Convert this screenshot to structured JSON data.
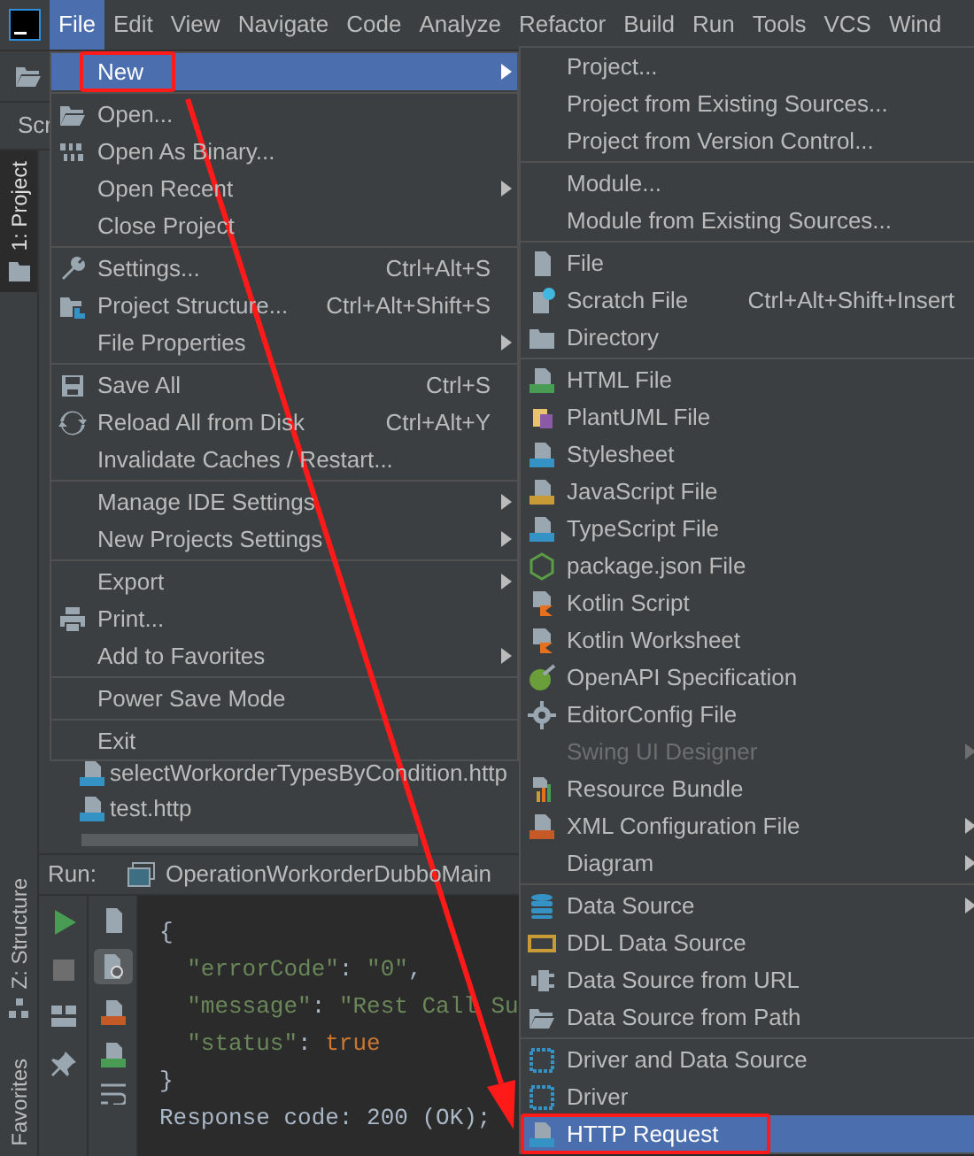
{
  "menu_bar": {
    "items": [
      {
        "label": "File",
        "selected": true
      },
      {
        "label": "Edit",
        "selected": false
      },
      {
        "label": "View",
        "selected": false
      },
      {
        "label": "Navigate",
        "selected": false
      },
      {
        "label": "Code",
        "selected": false
      },
      {
        "label": "Analyze",
        "selected": false
      },
      {
        "label": "Refactor",
        "selected": false
      },
      {
        "label": "Build",
        "selected": false
      },
      {
        "label": "Run",
        "selected": false
      },
      {
        "label": "Tools",
        "selected": false
      },
      {
        "label": "VCS",
        "selected": false
      },
      {
        "label": "Wind",
        "selected": false
      }
    ]
  },
  "tool_tab": "Scr",
  "side_stripe": [
    {
      "label": "1: Project",
      "selected": true
    },
    {
      "label": "Z: Structure",
      "selected": false
    },
    {
      "label": "Favorites",
      "selected": false
    }
  ],
  "project_tree": [
    {
      "name": "selectWorkorderTypesByCondition.http"
    },
    {
      "name": "test.http"
    }
  ],
  "run_panel": {
    "label": "Run:",
    "tab": "OperationWorkorderDubboMain",
    "console": [
      [
        {
          "kind": "punct",
          "text": "{"
        }
      ],
      [
        {
          "kind": "string",
          "text": "  \"errorCode\""
        },
        {
          "kind": "punct",
          "text": ": "
        },
        {
          "kind": "string",
          "text": "\"0\""
        },
        {
          "kind": "punct",
          "text": ","
        }
      ],
      [
        {
          "kind": "string",
          "text": "  \"message\""
        },
        {
          "kind": "punct",
          "text": ": "
        },
        {
          "kind": "string",
          "text": "\"Rest Call Su"
        }
      ],
      [
        {
          "kind": "string",
          "text": "  \"status\""
        },
        {
          "kind": "punct",
          "text": ": "
        },
        {
          "kind": "bool",
          "text": "true"
        }
      ],
      [
        {
          "kind": "punct",
          "text": "}"
        }
      ],
      [
        {
          "kind": "plain",
          "text": "Response code: 200 (OK);"
        }
      ]
    ]
  },
  "file_menu": {
    "groups": [
      [
        {
          "label": "New",
          "selected": true,
          "submenu": true,
          "boxed": true
        }
      ],
      [
        {
          "label": "Open...",
          "selected": false,
          "submenu": false,
          "boxed": false
        },
        {
          "label": "Open As Binary...",
          "selected": false,
          "submenu": false,
          "boxed": false
        },
        {
          "label": "Open Recent",
          "selected": false,
          "submenu": true,
          "boxed": false
        },
        {
          "label": "Close Project",
          "selected": false,
          "submenu": false,
          "boxed": false
        }
      ],
      [
        {
          "label": "Settings...",
          "shortcut": "Ctrl+Alt+S",
          "selected": false,
          "submenu": false,
          "boxed": false
        },
        {
          "label": "Project Structure...",
          "shortcut": "Ctrl+Alt+Shift+S",
          "selected": false,
          "submenu": false,
          "boxed": false
        },
        {
          "label": "File Properties",
          "selected": false,
          "submenu": true,
          "boxed": false
        }
      ],
      [
        {
          "label": "Save All",
          "shortcut": "Ctrl+S",
          "selected": false,
          "submenu": false,
          "boxed": false
        },
        {
          "label": "Reload All from Disk",
          "shortcut": "Ctrl+Alt+Y",
          "selected": false,
          "submenu": false,
          "boxed": false
        },
        {
          "label": "Invalidate Caches / Restart...",
          "selected": false,
          "submenu": false,
          "boxed": false
        }
      ],
      [
        {
          "label": "Manage IDE Settings",
          "selected": false,
          "submenu": true,
          "boxed": false
        },
        {
          "label": "New Projects Settings",
          "selected": false,
          "submenu": true,
          "boxed": false
        }
      ],
      [
        {
          "label": "Export",
          "selected": false,
          "submenu": true,
          "boxed": false
        },
        {
          "label": "Print...",
          "selected": false,
          "submenu": false,
          "boxed": false
        },
        {
          "label": "Add to Favorites",
          "selected": false,
          "submenu": true,
          "boxed": false
        }
      ],
      [
        {
          "label": "Power Save Mode",
          "selected": false,
          "submenu": false,
          "boxed": false
        }
      ],
      [
        {
          "label": "Exit",
          "selected": false,
          "submenu": false,
          "boxed": false
        }
      ]
    ]
  },
  "new_submenu": {
    "groups": [
      [
        {
          "label": "Project...",
          "selected": false,
          "submenu": false,
          "disabled": false,
          "boxed": false
        },
        {
          "label": "Project from Existing Sources...",
          "selected": false,
          "submenu": false,
          "disabled": false,
          "boxed": false
        },
        {
          "label": "Project from Version Control...",
          "selected": false,
          "submenu": false,
          "disabled": false,
          "boxed": false
        }
      ],
      [
        {
          "label": "Module...",
          "selected": false,
          "submenu": false,
          "disabled": false,
          "boxed": false
        },
        {
          "label": "Module from Existing Sources...",
          "selected": false,
          "submenu": false,
          "disabled": false,
          "boxed": false
        }
      ],
      [
        {
          "label": "File",
          "selected": false,
          "submenu": false,
          "disabled": false,
          "boxed": false
        },
        {
          "label": "Scratch File",
          "shortcut": "Ctrl+Alt+Shift+Insert",
          "selected": false,
          "submenu": false,
          "disabled": false,
          "boxed": false
        },
        {
          "label": "Directory",
          "selected": false,
          "submenu": false,
          "disabled": false,
          "boxed": false
        }
      ],
      [
        {
          "label": "HTML File",
          "selected": false,
          "submenu": false,
          "disabled": false,
          "boxed": false
        },
        {
          "label": "PlantUML File",
          "selected": false,
          "submenu": false,
          "disabled": false,
          "boxed": false
        },
        {
          "label": "Stylesheet",
          "selected": false,
          "submenu": false,
          "disabled": false,
          "boxed": false
        },
        {
          "label": "JavaScript File",
          "selected": false,
          "submenu": false,
          "disabled": false,
          "boxed": false
        },
        {
          "label": "TypeScript File",
          "selected": false,
          "submenu": false,
          "disabled": false,
          "boxed": false
        },
        {
          "label": "package.json File",
          "selected": false,
          "submenu": false,
          "disabled": false,
          "boxed": false
        },
        {
          "label": "Kotlin Script",
          "selected": false,
          "submenu": false,
          "disabled": false,
          "boxed": false
        },
        {
          "label": "Kotlin Worksheet",
          "selected": false,
          "submenu": false,
          "disabled": false,
          "boxed": false
        },
        {
          "label": "OpenAPI Specification",
          "selected": false,
          "submenu": false,
          "disabled": false,
          "boxed": false
        },
        {
          "label": "EditorConfig File",
          "selected": false,
          "submenu": false,
          "disabled": false,
          "boxed": false
        },
        {
          "label": "Swing UI Designer",
          "selected": false,
          "submenu": true,
          "disabled": true,
          "boxed": false
        },
        {
          "label": "Resource Bundle",
          "selected": false,
          "submenu": false,
          "disabled": false,
          "boxed": false
        },
        {
          "label": "XML Configuration File",
          "selected": false,
          "submenu": true,
          "disabled": false,
          "boxed": false
        },
        {
          "label": "Diagram",
          "selected": false,
          "submenu": true,
          "disabled": false,
          "boxed": false
        }
      ],
      [
        {
          "label": "Data Source",
          "selected": false,
          "submenu": true,
          "disabled": false,
          "boxed": false
        },
        {
          "label": "DDL Data Source",
          "selected": false,
          "submenu": false,
          "disabled": false,
          "boxed": false
        },
        {
          "label": "Data Source from URL",
          "selected": false,
          "submenu": false,
          "disabled": false,
          "boxed": false
        },
        {
          "label": "Data Source from Path",
          "selected": false,
          "submenu": false,
          "disabled": false,
          "boxed": false
        }
      ],
      [
        {
          "label": "Driver and Data Source",
          "selected": false,
          "submenu": false,
          "disabled": false,
          "boxed": false
        },
        {
          "label": "Driver",
          "selected": false,
          "submenu": false,
          "disabled": false,
          "boxed": false
        },
        {
          "label": "HTTP Request",
          "selected": true,
          "submenu": false,
          "disabled": false,
          "boxed": true
        }
      ]
    ]
  },
  "annotation_arrow": true
}
